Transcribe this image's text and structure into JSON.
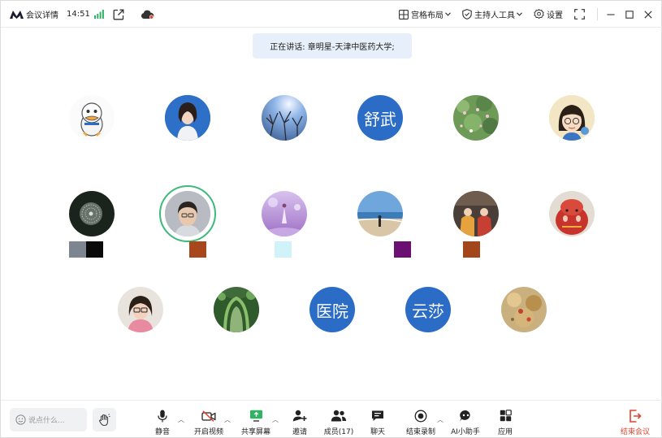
{
  "topbar": {
    "meeting_details": "会议详情",
    "clock": "14:51",
    "layout_label": "宫格布局",
    "host_tools_label": "主持人工具",
    "settings_label": "设置"
  },
  "banner": {
    "speaking_text": "正在讲话: 章明星-天津中医药大学;"
  },
  "participants": {
    "text_avatar_1": "舒武",
    "text_avatar_2": "医院",
    "text_avatar_3": "云莎"
  },
  "bottombar": {
    "chat_placeholder": "说点什么...",
    "mute": "静音",
    "start_video": "开启视频",
    "share_screen": "共享屏幕",
    "invite": "邀请",
    "members": "成员(17)",
    "chat": "聊天",
    "end_recording": "结束录制",
    "ai_assistant": "AI小助手",
    "apps": "应用",
    "end_meeting": "结束会议"
  },
  "colors": {
    "accent_blue": "#2a6cc6",
    "speaking_ring": "#3cba7a",
    "signal_green": "#2fb463",
    "end_red": "#e0442f",
    "banner_bg": "#e7effa"
  },
  "icons": [
    "logo-icon",
    "signal-icon",
    "external-link-icon",
    "cloud-record-icon",
    "grid-layout-icon",
    "shield-icon",
    "gear-icon",
    "fullscreen-icon",
    "minimize-icon",
    "maximize-icon",
    "close-icon",
    "smile-icon",
    "raise-hand-icon",
    "mic-icon",
    "video-off-icon",
    "share-screen-icon",
    "invite-icon",
    "members-icon",
    "chat-icon",
    "record-stop-icon",
    "ai-assistant-icon",
    "apps-icon",
    "exit-icon"
  ]
}
